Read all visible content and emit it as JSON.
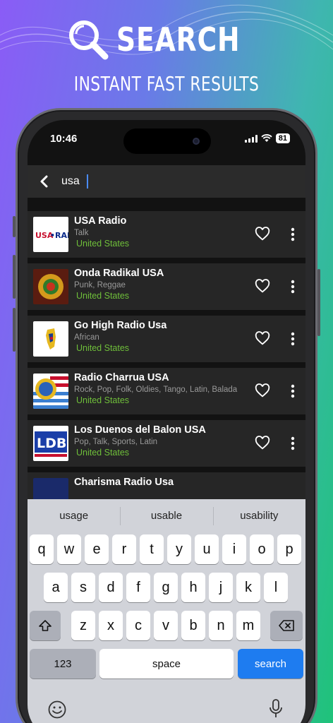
{
  "hero": {
    "title": "SEARCH",
    "subtitle": "INSTANT FAST RESULTS"
  },
  "status": {
    "time": "10:46",
    "battery": "81"
  },
  "search": {
    "query": "usa"
  },
  "results": [
    {
      "name": "USA Radio",
      "genre": "Talk",
      "country": "United States",
      "logo": "usa-radio-logo"
    },
    {
      "name": "Onda Radikal USA",
      "genre": "Punk, Reggae",
      "country": "United States",
      "logo": "onda-radikal-logo"
    },
    {
      "name": "Go High Radio Usa",
      "genre": "African",
      "country": "United States",
      "logo": "go-high-logo"
    },
    {
      "name": "Radio Charrua USA",
      "genre": "Rock, Pop, Folk, Oldies, Tango, Latin, Balada",
      "country": "United States",
      "logo": "charrua-logo"
    },
    {
      "name": "Los Duenos del Balon USA",
      "genre": "Pop, Talk, Sports, Latin",
      "country": "United States",
      "logo": "ldb-logo"
    },
    {
      "name": "Charisma Radio Usa",
      "genre": "",
      "country": "",
      "logo": "charisma-logo"
    }
  ],
  "keyboard": {
    "suggestions": [
      "usage",
      "usable",
      "usability"
    ],
    "row1": [
      "q",
      "w",
      "e",
      "r",
      "t",
      "y",
      "u",
      "i",
      "o",
      "p"
    ],
    "row2": [
      "a",
      "s",
      "d",
      "f",
      "g",
      "h",
      "j",
      "k",
      "l"
    ],
    "row3": [
      "z",
      "x",
      "c",
      "v",
      "b",
      "n",
      "m"
    ],
    "numbers_label": "123",
    "space_label": "space",
    "search_label": "search"
  },
  "colors": {
    "accent_green": "#6fbf3a",
    "search_key_blue": "#1e7cf0",
    "list_bg": "#262626"
  }
}
